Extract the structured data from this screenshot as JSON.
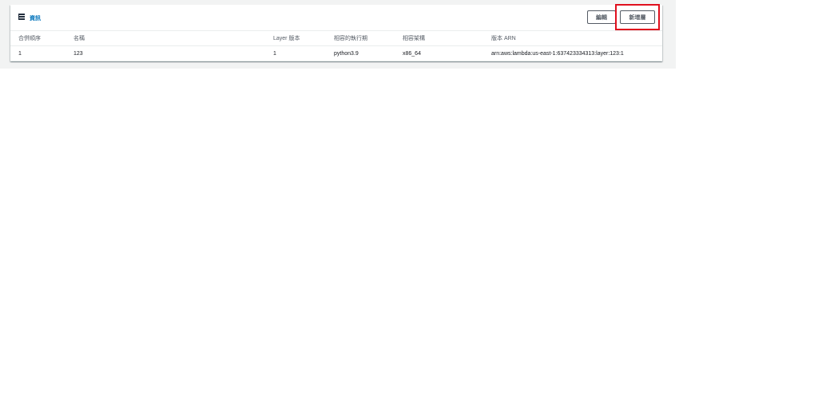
{
  "header": {
    "icon": "layers-icon",
    "info_label": "資訊",
    "edit_label": "編輯",
    "add_label": "新增層"
  },
  "table": {
    "columns": [
      "合併順序",
      "名稱",
      "Layer 版本",
      "相容的執行期",
      "相容架構",
      "版本 ARN"
    ],
    "rows": [
      [
        "1",
        "123",
        "1",
        "python3.9",
        "x86_64",
        "arn:aws:lambda:us-east-1:637423334313:layer:123:1"
      ]
    ]
  },
  "colors": {
    "highlight": "#e0101e",
    "link": "#0073bb",
    "background_band": "#f2f3f3"
  }
}
